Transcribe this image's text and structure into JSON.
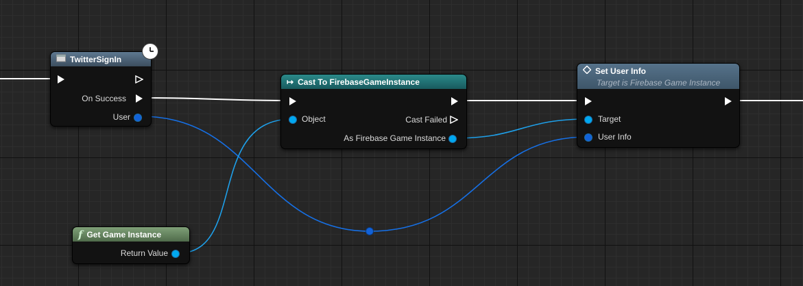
{
  "graph": {
    "twitter_node": {
      "title": "TwitterSignIn",
      "header_icon": "function-library-icon",
      "latent_icon": "clock-icon",
      "outputs": {
        "on_success": "On Success",
        "user": "User"
      }
    },
    "cast_node": {
      "title": "Cast To FirebaseGameInstance",
      "header_icon": "cast-arrow-icon",
      "inputs": {
        "object": "Object"
      },
      "outputs": {
        "cast_failed": "Cast Failed",
        "as_instance": "As Firebase Game Instance"
      }
    },
    "setinfo_node": {
      "title": "Set User Info",
      "subtitle": "Target is Firebase Game Instance",
      "header_icon": "diamond-icon",
      "inputs": {
        "target": "Target",
        "user_info": "User Info"
      }
    },
    "getgame_node": {
      "title": "Get Game Instance",
      "header_icon": "function-f-icon",
      "outputs": {
        "return_value": "Return Value"
      }
    },
    "colors": {
      "exec_wire": "#ffffff",
      "object_pin": "#00a8f0",
      "struct_pin": "#1262d8"
    }
  }
}
